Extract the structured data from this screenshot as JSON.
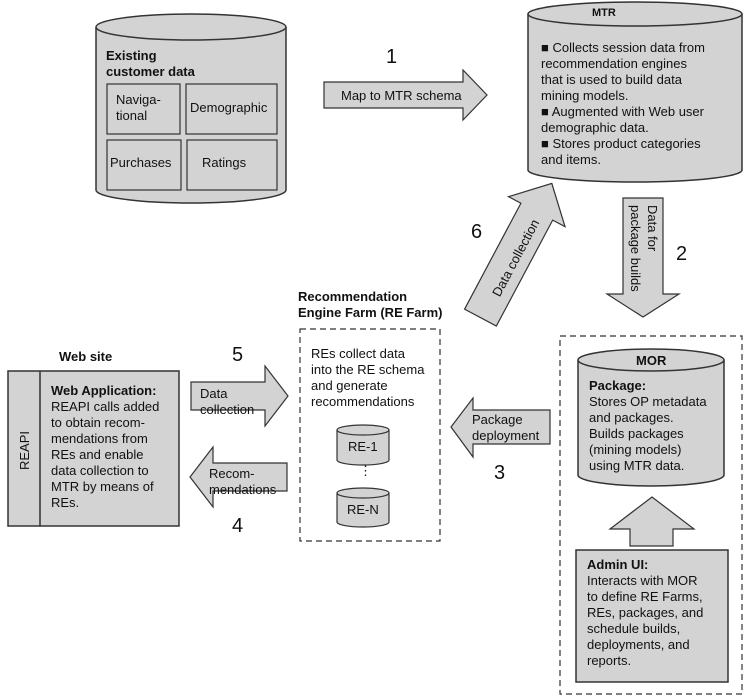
{
  "existing_data": {
    "title": "Existing\ncustomer data",
    "cells": [
      "Naviga-\ntional",
      "Demographic",
      "Purchases",
      "Ratings"
    ]
  },
  "step1": {
    "number": "1",
    "label": "Map to MTR schema"
  },
  "mtr": {
    "title": "MTR",
    "bullet": "■",
    "items": [
      "Collects session data from\nrecommendation engines\nthat is used to build data\nmining models.",
      "Augmented with Web user\ndemographic data.",
      "Stores product categories\nand items."
    ]
  },
  "step6": {
    "number": "6",
    "label": "Data collection"
  },
  "step2": {
    "number": "2",
    "label": "Data for\npackage builds"
  },
  "re_farm": {
    "title": "Recommendation\nEngine Farm (RE Farm)",
    "description": "REs collect data\ninto the RE schema\nand generate\nrecommendations",
    "engines": [
      "RE-1",
      "RE-N"
    ],
    "ellipsis": "⋮"
  },
  "web_site": {
    "title": "Web site",
    "api_label": "REAPI",
    "app_title": "Web Application:",
    "app_text": "REAPI calls added\nto obtain recom-\nmendations from\nREs and enable\ndata collection to\nMTR by means of\nREs."
  },
  "step5": {
    "number": "5",
    "label": "Data\ncollection"
  },
  "step4": {
    "number": "4",
    "label": "Recom-\nmendations"
  },
  "step3": {
    "number": "3",
    "label": "Package\ndeployment"
  },
  "mor": {
    "title": "MOR",
    "package_title": "Package:",
    "package_text": "Stores OP metadata\nand packages.\nBuilds packages\n(mining models)\nusing MTR data."
  },
  "admin_ui": {
    "title": "Admin UI:",
    "text": "Interacts with MOR\nto define RE Farms,\nREs, packages, and\nschedule builds,\ndeployments, and\nreports."
  },
  "colors": {
    "fill": "#d3d3d3",
    "stroke": "#333333"
  }
}
